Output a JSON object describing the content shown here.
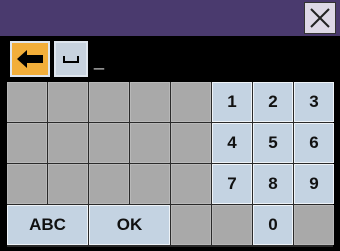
{
  "title_bar": {
    "close_icon": "close-x-icon"
  },
  "input": {
    "backspace_icon": "left-arrow-icon",
    "space_icon": "space-bar-icon",
    "value": "_"
  },
  "keypad": {
    "digits": [
      "1",
      "2",
      "3",
      "4",
      "5",
      "6",
      "7",
      "8",
      "9",
      "0"
    ],
    "abc_label": "ABC",
    "ok_label": "OK"
  },
  "colors": {
    "title_bar": "#4a3a6e",
    "backspace_accent": "#f2ae3a",
    "key_face": "#c4d3e2",
    "empty_cell": "#a9a9a9"
  }
}
